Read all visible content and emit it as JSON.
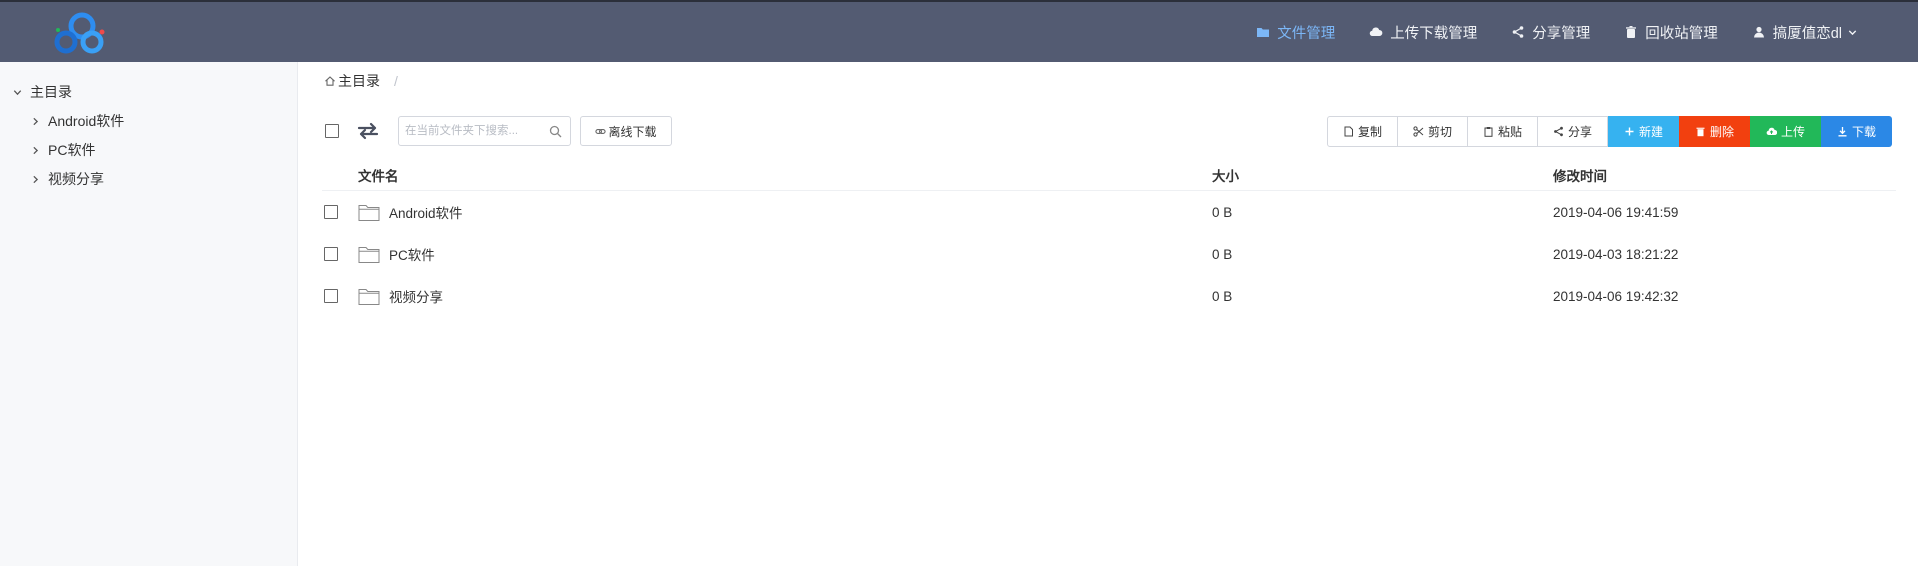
{
  "header": {
    "nav": [
      {
        "label": "文件管理",
        "icon": "folder-icon",
        "active": true
      },
      {
        "label": "上传下载管理",
        "icon": "cloud-icon",
        "active": false
      },
      {
        "label": "分享管理",
        "icon": "share-icon",
        "active": false
      },
      {
        "label": "回收站管理",
        "icon": "trash-icon",
        "active": false
      },
      {
        "label": "搞厦值恋dl",
        "icon": "user-icon",
        "active": false
      }
    ]
  },
  "sidebar": {
    "root": "主目录",
    "items": [
      {
        "label": "Android软件"
      },
      {
        "label": "PC软件"
      },
      {
        "label": "视频分享"
      }
    ]
  },
  "breadcrumb": {
    "home": "主目录",
    "separator": "/"
  },
  "search": {
    "placeholder": "在当前文件夹下搜索..."
  },
  "offline_download": {
    "label": "离线下载"
  },
  "toolbar": {
    "copy": "复制",
    "cut": "剪切",
    "paste": "粘贴",
    "share": "分享",
    "new": "新建",
    "delete": "删除",
    "upload": "上传",
    "download": "下载"
  },
  "colors": {
    "header_bg": "#535b72",
    "nav_active": "#7cb7f7",
    "new": "#36b2f0",
    "delete": "#f2400f",
    "upload": "#22b859",
    "download": "#2b88e6"
  },
  "table": {
    "columns": [
      "文件名",
      "大小",
      "修改时间"
    ],
    "rows": [
      {
        "name": "Android软件",
        "size": "0 B",
        "modified": "2019-04-06 19:41:59"
      },
      {
        "name": "PC软件",
        "size": "0 B",
        "modified": "2019-04-03 18:21:22"
      },
      {
        "name": "视频分享",
        "size": "0 B",
        "modified": "2019-04-06 19:42:32"
      }
    ]
  }
}
